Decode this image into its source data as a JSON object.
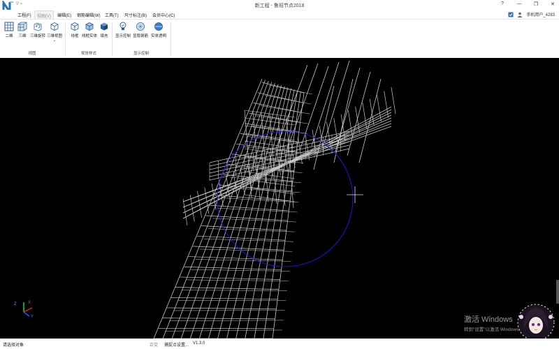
{
  "window": {
    "title": "新工程 - 鲁班节点2018",
    "qat": "∇ ="
  },
  "menu": [
    "工程(F)",
    "视图(V)",
    "编辑(E)",
    "钢筋编辑(W)",
    "工具(T)",
    "尺寸标注(B)",
    "会员中心(C)"
  ],
  "user": "手机用户_4283",
  "ribbon": {
    "groups": [
      {
        "label": "视图",
        "buttons": [
          {
            "label": "二维",
            "icon": "grid-2d-icon"
          },
          {
            "label": "三维",
            "icon": "grid-3d-icon"
          },
          {
            "label": "三维旋转",
            "icon": "cube-rotate-icon"
          },
          {
            "label": "三维视图",
            "icon": "cube-view-icon"
          }
        ]
      },
      {
        "label": "视觉样式",
        "buttons": [
          {
            "label": "线框",
            "icon": "wireframe-icon"
          },
          {
            "label": "线框实体",
            "icon": "wire-solid-icon"
          },
          {
            "label": "填充",
            "icon": "solid-fill-icon"
          }
        ]
      },
      {
        "label": "显示控制",
        "buttons": [
          {
            "label": "显示控制",
            "icon": "display-control-icon"
          },
          {
            "label": "显隐钢筋",
            "icon": "toggle-rebar-icon"
          },
          {
            "label": "实体透明",
            "icon": "transparent-solid-icon"
          }
        ]
      }
    ]
  },
  "status": {
    "prompt": "请选择对象",
    "ortho": "正交",
    "snap": "捕捉点设置...",
    "version": "V1.3.0"
  },
  "watermark": {
    "line1": "激活 Windows",
    "line2": "转到\"设置\"以激活 Windows。"
  },
  "axis": {
    "x": "X",
    "y": "Y",
    "z": "Z"
  },
  "colors": {
    "viewport_bg": "#000000",
    "rebar": "#c8c8c8",
    "orbit_circle": "#1a1acc",
    "ribbon_icon": "#2a5d96"
  }
}
